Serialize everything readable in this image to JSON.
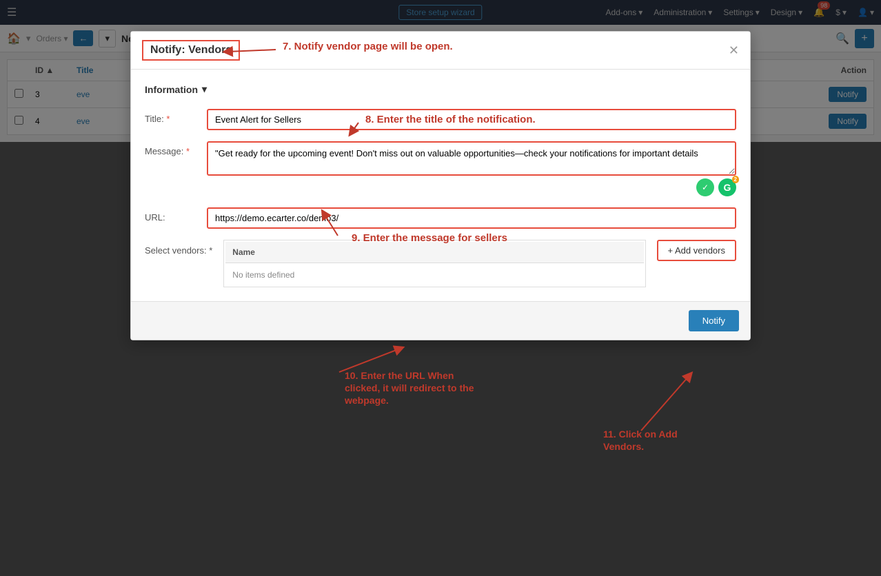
{
  "topnav": {
    "wizard_label": "Store setup wizard",
    "addons_label": "Add-ons",
    "administration_label": "Administration",
    "settings_label": "Settings",
    "design_label": "Design",
    "notification_count": "98",
    "dollar_label": "$",
    "user_label": "👤"
  },
  "subnav": {
    "breadcrumb": "Notify",
    "plus_label": "+",
    "back_label": "←",
    "dropdown_label": "▾"
  },
  "table": {
    "columns": [
      "",
      "ID ▲",
      "Title",
      "Action"
    ],
    "rows": [
      {
        "id": "3",
        "title": "eve",
        "action": "Notify"
      },
      {
        "id": "4",
        "title": "eve",
        "action": "Notify"
      }
    ]
  },
  "modal": {
    "title": "Notify: Vendors",
    "close_label": "✕",
    "section_label": "Information",
    "section_dropdown": "▾",
    "title_label": "Title:",
    "title_required": "*",
    "title_value": "Event Alert for Sellers",
    "message_label": "Message:",
    "message_required": "*",
    "message_value": "\"Get ready for the upcoming event! Don't miss out on valuable opportunities—check your notifications for important details",
    "url_label": "URL:",
    "url_value": "https://demo.ecarter.co/demo3/",
    "select_vendors_label": "Select vendors:",
    "select_vendors_required": "*",
    "vendors_col_name": "Name",
    "vendors_no_items": "No items defined",
    "add_vendors_label": "+ Add vendors",
    "notify_btn_label": "Notify"
  },
  "annotations": {
    "step7": "7. Notify vendor page will be open.",
    "step8": "8. Enter the title of the notification.",
    "step9": "9. Enter the message for sellers",
    "step10": "10. Enter the URL When clicked, it will redirect to the webpage.",
    "step11": "11. Click on Add Vendors."
  }
}
